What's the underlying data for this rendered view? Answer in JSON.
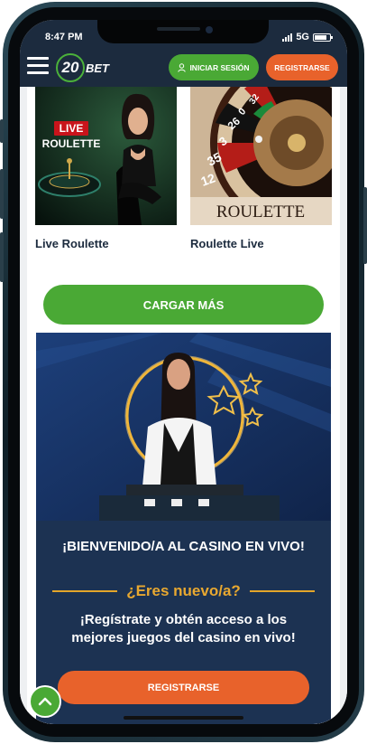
{
  "status": {
    "time": "8:47 PM",
    "network": "5G"
  },
  "header": {
    "logo_number": "20",
    "logo_text": "BET",
    "login_label": "INICIAR SESIÓN",
    "register_label": "REGISTRARSE"
  },
  "games": [
    {
      "title": "Live Roulette",
      "image_label_top": "LIVE",
      "image_label_bottom": "ROULETTE"
    },
    {
      "title": "Roulette Live",
      "image_label": "ROULETTE",
      "wheel_numbers": [
        "12",
        "35",
        "3",
        "26",
        "0",
        "32"
      ]
    }
  ],
  "load_more_label": "CARGAR MÁS",
  "promo": {
    "title": "¡BIENVENIDO/A AL CASINO EN VIVO!",
    "subtitle": "¿Eres nuevo/a?",
    "description": "¡Regístrate y obtén acceso a los mejores juegos del casino en vivo!",
    "button_label": "REGISTRARSE"
  },
  "colors": {
    "navy": "#1c2b3e",
    "green": "#4aa935",
    "orange": "#e8622b",
    "gold": "#e8a830"
  }
}
